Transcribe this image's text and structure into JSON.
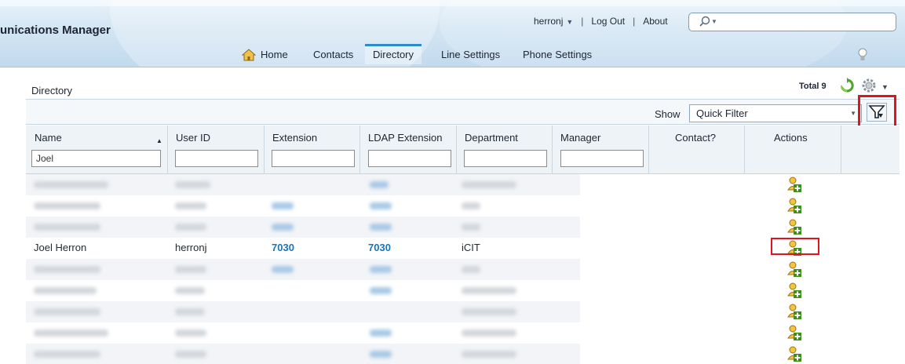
{
  "header": {
    "app_title": "unications Manager",
    "user": "herronj",
    "logout": "Log Out",
    "about": "About",
    "search_placeholder": ""
  },
  "nav": {
    "tabs": [
      {
        "label": "Home",
        "icon": "home-icon"
      },
      {
        "label": "Contacts"
      },
      {
        "label": "Directory",
        "active": true
      },
      {
        "label": "Line Settings"
      },
      {
        "label": "Phone Settings"
      }
    ]
  },
  "panel": {
    "title": "Directory",
    "total": "Total 9"
  },
  "toolbar": {
    "show_label": "Show",
    "filter_value": "Quick Filter"
  },
  "table": {
    "columns": [
      "Name",
      "User ID",
      "Extension",
      "LDAP Extension",
      "Department",
      "Manager",
      "Contact?",
      "Actions"
    ],
    "name_filter": "Joel",
    "visible_row": {
      "name": "Joel Herron",
      "user_id": "herronj",
      "extension": "7030",
      "ldap_extension": "7030",
      "department": "iCIT"
    }
  },
  "colors": {
    "accent": "#2a8cc8",
    "link": "#1576bd",
    "highlight": "#e0141e"
  }
}
